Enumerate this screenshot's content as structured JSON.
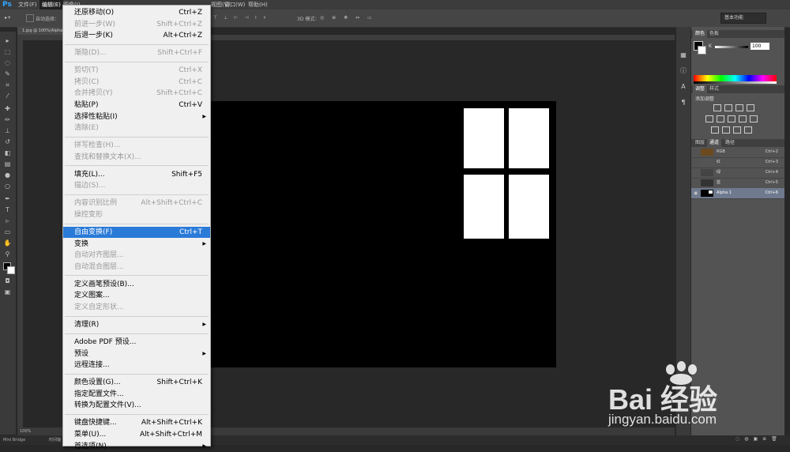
{
  "app": {
    "logo": "Ps"
  },
  "menubar": {
    "items": [
      "文件(F)",
      "编辑(E)",
      "图像(I)",
      "图层(L)",
      "文字(Y)",
      "选择(S)",
      "滤镜(T)",
      "3D(D)",
      "视图(V)",
      "窗口(W)",
      "帮助(H)"
    ]
  },
  "options": {
    "auto_select": "自动选择：",
    "mode_3d": "3D 模式：",
    "workspace": "基本功能"
  },
  "document": {
    "tab": "1.jpg @ 100%(Alpha 1, RGB/8)",
    "zoom": "100%"
  },
  "bottom": {
    "mini_bridge": "Mini Bridge",
    "timeline": "时间轴"
  },
  "edit_menu": {
    "items": [
      {
        "label": "还原移动(O)",
        "shortcut": "Ctrl+Z",
        "state": "normal"
      },
      {
        "label": "前进一步(W)",
        "shortcut": "Shift+Ctrl+Z",
        "state": "disabled"
      },
      {
        "label": "后退一步(K)",
        "shortcut": "Alt+Ctrl+Z",
        "state": "normal"
      },
      {
        "label": "渐隐(D)...",
        "shortcut": "Shift+Ctrl+F",
        "state": "disabled"
      },
      {
        "label": "剪切(T)",
        "shortcut": "Ctrl+X",
        "state": "disabled"
      },
      {
        "label": "拷贝(C)",
        "shortcut": "Ctrl+C",
        "state": "disabled"
      },
      {
        "label": "合并拷贝(Y)",
        "shortcut": "Shift+Ctrl+C",
        "state": "disabled"
      },
      {
        "label": "粘贴(P)",
        "shortcut": "Ctrl+V",
        "state": "normal"
      },
      {
        "label": "选择性粘贴(I)",
        "shortcut": "",
        "state": "normal",
        "submenu": true
      },
      {
        "label": "清除(E)",
        "shortcut": "",
        "state": "disabled"
      },
      {
        "label": "拼写检查(H)...",
        "shortcut": "",
        "state": "disabled"
      },
      {
        "label": "查找和替换文本(X)...",
        "shortcut": "",
        "state": "disabled"
      },
      {
        "label": "填充(L)...",
        "shortcut": "Shift+F5",
        "state": "normal"
      },
      {
        "label": "描边(S)...",
        "shortcut": "",
        "state": "disabled"
      },
      {
        "label": "内容识别比例",
        "shortcut": "Alt+Shift+Ctrl+C",
        "state": "disabled"
      },
      {
        "label": "操控变形",
        "shortcut": "",
        "state": "disabled"
      },
      {
        "label": "自由变换(F)",
        "shortcut": "Ctrl+T",
        "state": "highlighted"
      },
      {
        "label": "变换",
        "shortcut": "",
        "state": "normal",
        "submenu": true
      },
      {
        "label": "自动对齐图层...",
        "shortcut": "",
        "state": "disabled"
      },
      {
        "label": "自动混合图层...",
        "shortcut": "",
        "state": "disabled"
      },
      {
        "label": "定义画笔预设(B)...",
        "shortcut": "",
        "state": "normal"
      },
      {
        "label": "定义图案...",
        "shortcut": "",
        "state": "normal"
      },
      {
        "label": "定义自定形状...",
        "shortcut": "",
        "state": "disabled"
      },
      {
        "label": "清理(R)",
        "shortcut": "",
        "state": "normal",
        "submenu": true
      },
      {
        "label": "Adobe PDF 预设...",
        "shortcut": "",
        "state": "normal"
      },
      {
        "label": "预设",
        "shortcut": "",
        "state": "normal",
        "submenu": true
      },
      {
        "label": "远程连接...",
        "shortcut": "",
        "state": "normal"
      },
      {
        "label": "颜色设置(G)...",
        "shortcut": "Shift+Ctrl+K",
        "state": "normal"
      },
      {
        "label": "指定配置文件...",
        "shortcut": "",
        "state": "normal"
      },
      {
        "label": "转换为配置文件(V)...",
        "shortcut": "",
        "state": "normal"
      },
      {
        "label": "键盘快捷键...",
        "shortcut": "Alt+Shift+Ctrl+K",
        "state": "normal"
      },
      {
        "label": "菜单(U)...",
        "shortcut": "Alt+Shift+Ctrl+M",
        "state": "normal"
      },
      {
        "label": "首选项(N)",
        "shortcut": "",
        "state": "normal",
        "submenu": true
      }
    ]
  },
  "panels": {
    "color_tabs": [
      "颜色",
      "色板"
    ],
    "color_k_label": "K",
    "color_k_value": "100",
    "adjust_tabs": [
      "调整",
      "样式"
    ],
    "adjust_title": "添加调整",
    "channel_tabs": [
      "图层",
      "通道",
      "路径"
    ],
    "channels": [
      {
        "name": "RGB",
        "shortcut": "Ctrl+2",
        "selected": false
      },
      {
        "name": "红",
        "shortcut": "Ctrl+3",
        "selected": false
      },
      {
        "name": "绿",
        "shortcut": "Ctrl+4",
        "selected": false
      },
      {
        "name": "蓝",
        "shortcut": "Ctrl+5",
        "selected": false
      },
      {
        "name": "Alpha 1",
        "shortcut": "Ctrl+6",
        "selected": true
      }
    ]
  },
  "watermark": {
    "logo": "Bai 经验",
    "url": "jingyan.baidu.com"
  }
}
